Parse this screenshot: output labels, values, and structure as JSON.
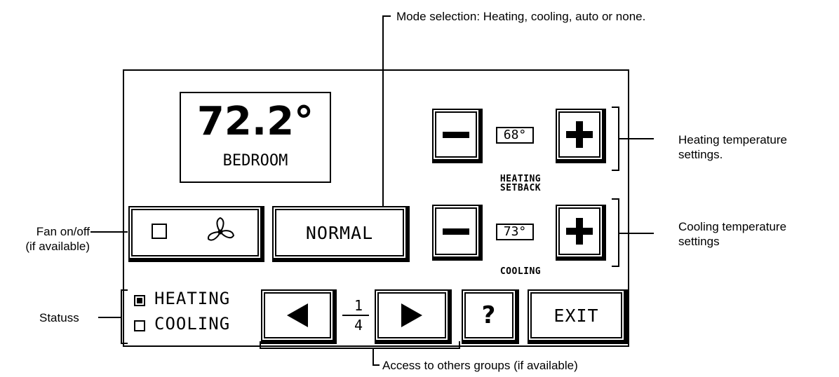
{
  "annotations": {
    "mode_selection": "Mode selection: Heating, cooling, auto or none.",
    "heating_settings_line1": "Heating temperature",
    "heating_settings_line2": "settings.",
    "cooling_settings_line1": "Cooling temperature",
    "cooling_settings_line2": "settings",
    "fan_line1": "Fan on/off",
    "fan_line2": "(if available)",
    "status": "Statuss",
    "groups_access": "Access to others groups (if available)"
  },
  "display": {
    "temperature": "72.2°",
    "room": "BEDROOM"
  },
  "heating": {
    "setpoint": "68°",
    "label_line1": "HEATING",
    "label_line2": "SETBACK",
    "minus": "−",
    "plus": "+"
  },
  "cooling": {
    "setpoint": "73°",
    "label": "COOLING",
    "minus": "−",
    "plus": "+"
  },
  "mode_button": "NORMAL",
  "status_list": [
    {
      "label": "HEATING",
      "checked": true
    },
    {
      "label": "COOLING",
      "checked": false
    }
  ],
  "pager": {
    "current": "1",
    "total": "4"
  },
  "help_button": "?",
  "exit_button": "EXIT"
}
